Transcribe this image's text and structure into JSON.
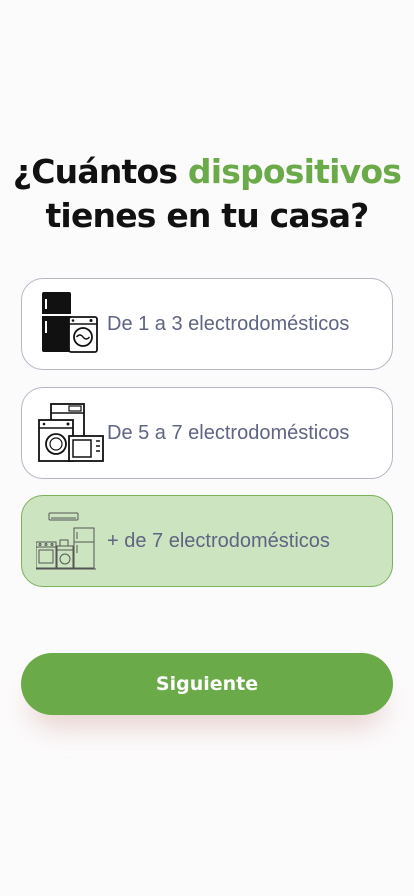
{
  "question": {
    "part1": "¿Cuántos ",
    "highlight": "dispositivos",
    "part2": "tienes en tu casa?"
  },
  "options": [
    {
      "label": "De 1 a 3 electrodomésticos",
      "icon": "fridge-washer-icon",
      "selected": false
    },
    {
      "label": "De 5 a 7 electrodomésticos",
      "icon": "appliances-icon",
      "selected": false
    },
    {
      "label": "+ de 7 electrodomésticos",
      "icon": "home-appliances-icon",
      "selected": true
    }
  ],
  "next_button": {
    "label": "Siguiente"
  },
  "colors": {
    "accent": "#6aaa48",
    "selected_bg": "#cce5c0",
    "text": "#5f6483"
  }
}
